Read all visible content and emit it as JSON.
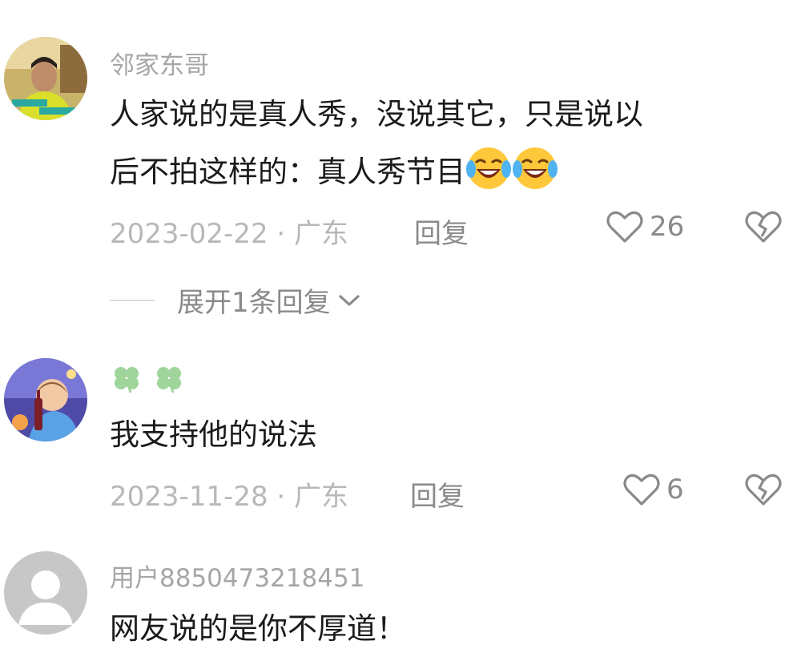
{
  "comments": [
    {
      "username": "邻家东哥",
      "text_line1": "人家说的是真人秀，没说其它，只是说以",
      "text_line2": "后不拍这样的：真人秀节目",
      "emoji": "laughing-crying-emoji",
      "date_location": "2023-02-22 · 广东",
      "reply_label": "回复",
      "like_count": "26",
      "expand_replies_label": "展开1条回复"
    },
    {
      "username_icons": [
        "clover-icon",
        "clover-icon"
      ],
      "text_line1": "我支持他的说法",
      "date_location": "2023-11-28 · 广东",
      "reply_label": "回复",
      "like_count": "6"
    },
    {
      "username": "用户8850473218451",
      "text_line1": "网友说的是你不厚道！"
    }
  ],
  "colors": {
    "username": "#a6a6a6",
    "body_text": "#1b1b1b",
    "meta_text": "#b8b8b8",
    "action_text": "#8a8a8a",
    "clover": "#9fd59a"
  }
}
